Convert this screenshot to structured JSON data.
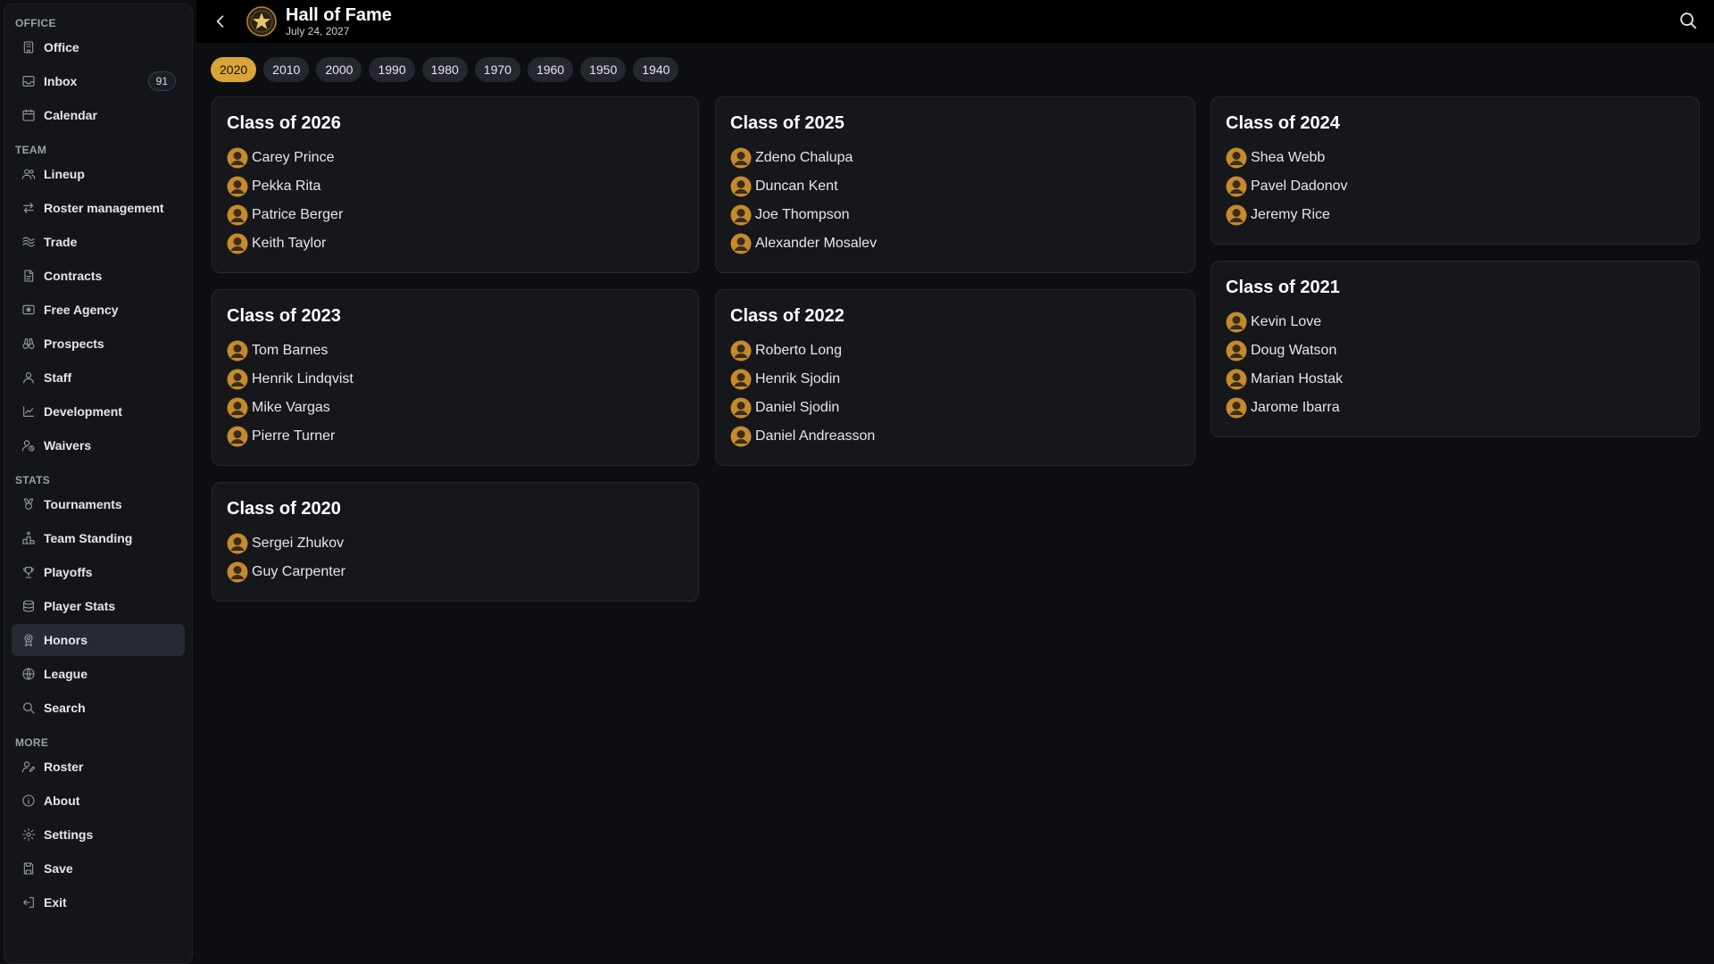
{
  "header": {
    "title": "Hall of Fame",
    "date": "July 24, 2027"
  },
  "sidebar": {
    "sections": [
      {
        "label": "OFFICE",
        "items": [
          {
            "label": "Office",
            "icon": "building-icon"
          },
          {
            "label": "Inbox",
            "icon": "inbox-icon",
            "badge": "91"
          },
          {
            "label": "Calendar",
            "icon": "calendar-icon"
          }
        ]
      },
      {
        "label": "TEAM",
        "items": [
          {
            "label": "Lineup",
            "icon": "users-icon"
          },
          {
            "label": "Roster management",
            "icon": "arrows-icon"
          },
          {
            "label": "Trade",
            "icon": "trade-icon"
          },
          {
            "label": "Contracts",
            "icon": "contract-icon"
          },
          {
            "label": "Free Agency",
            "icon": "id-card-icon"
          },
          {
            "label": "Prospects",
            "icon": "binoculars-icon"
          },
          {
            "label": "Staff",
            "icon": "user-icon"
          },
          {
            "label": "Development",
            "icon": "chart-icon"
          },
          {
            "label": "Waivers",
            "icon": "user-clock-icon"
          }
        ]
      },
      {
        "label": "STATS",
        "items": [
          {
            "label": "Tournaments",
            "icon": "medal-icon"
          },
          {
            "label": "Team Standing",
            "icon": "podium-icon"
          },
          {
            "label": "Playoffs",
            "icon": "trophy-icon"
          },
          {
            "label": "Player Stats",
            "icon": "database-icon"
          },
          {
            "label": "Honors",
            "icon": "award-icon",
            "active": true
          },
          {
            "label": "League",
            "icon": "globe-icon"
          },
          {
            "label": "Search",
            "icon": "search-icon"
          }
        ]
      },
      {
        "label": "MORE",
        "items": [
          {
            "label": "Roster",
            "icon": "user-edit-icon"
          },
          {
            "label": "About",
            "icon": "info-icon"
          },
          {
            "label": "Settings",
            "icon": "gear-icon"
          },
          {
            "label": "Save",
            "icon": "save-icon"
          },
          {
            "label": "Exit",
            "icon": "exit-icon"
          }
        ]
      }
    ]
  },
  "decades": {
    "items": [
      "2020",
      "2010",
      "2000",
      "1990",
      "1980",
      "1970",
      "1960",
      "1950",
      "1940"
    ],
    "active": "2020"
  },
  "classes": [
    {
      "title": "Class of 2026",
      "members": [
        "Carey Prince",
        "Pekka Rita",
        "Patrice Berger",
        "Keith Taylor"
      ]
    },
    {
      "title": "Class of 2025",
      "members": [
        "Zdeno Chalupa",
        "Duncan Kent",
        "Joe Thompson",
        "Alexander Mosalev"
      ]
    },
    {
      "title": "Class of 2024",
      "members": [
        "Shea Webb",
        "Pavel Dadonov",
        "Jeremy Rice"
      ]
    },
    {
      "title": "Class of 2023",
      "members": [
        "Tom Barnes",
        "Henrik Lindqvist",
        "Mike Vargas",
        "Pierre Turner"
      ]
    },
    {
      "title": "Class of 2022",
      "members": [
        "Roberto Long",
        "Henrik Sjodin",
        "Daniel Sjodin",
        "Daniel Andreasson"
      ]
    },
    {
      "title": "Class of 2021",
      "members": [
        "Kevin Love",
        "Doug Watson",
        "Marian Hostak",
        "Jarome Ibarra"
      ]
    },
    {
      "title": "Class of 2020",
      "members": [
        "Sergei Zhukov",
        "Guy Carpenter"
      ]
    }
  ],
  "colors": {
    "accent": "#d9a43a",
    "background": "#0d0e11",
    "card": "#15171b"
  }
}
